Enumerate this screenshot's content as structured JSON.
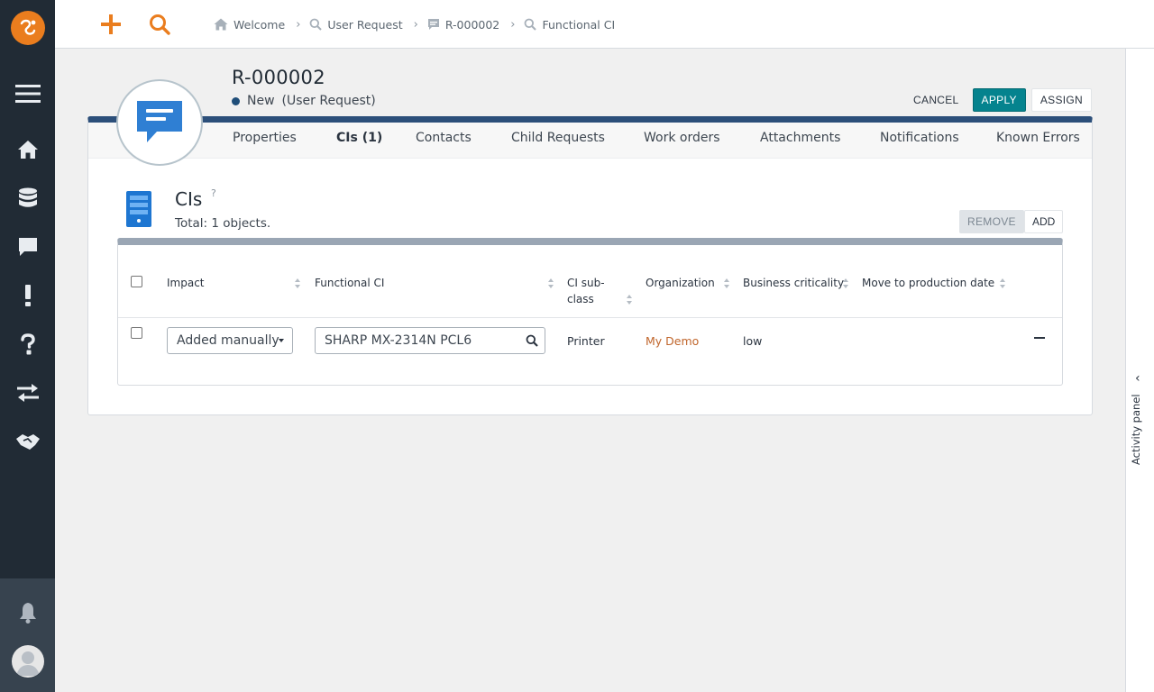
{
  "topbar": {
    "breadcrumb": [
      {
        "label": "Welcome",
        "icon": "home-icon"
      },
      {
        "label": "User Request",
        "icon": "search-icon"
      },
      {
        "label": "R-000002",
        "icon": "ticket-icon"
      },
      {
        "label": "Functional CI",
        "icon": "search-icon"
      }
    ]
  },
  "object": {
    "title": "R-000002",
    "status": "New",
    "class_label": "(User Request)",
    "actions": {
      "cancel": "CANCEL",
      "apply": "APPLY",
      "assign": "ASSIGN"
    }
  },
  "tabs": [
    {
      "label": "Properties",
      "active": false
    },
    {
      "label": "CIs (1)",
      "active": true
    },
    {
      "label": "Contacts",
      "active": false
    },
    {
      "label": "Child Requests",
      "active": false
    },
    {
      "label": "Work orders",
      "active": false
    },
    {
      "label": "Attachments",
      "active": false
    },
    {
      "label": "Notifications",
      "active": false
    },
    {
      "label": "Known Errors",
      "active": false
    }
  ],
  "cis": {
    "title": "CIs",
    "help": "?",
    "total": "Total: 1 objects.",
    "remove_label": "REMOVE",
    "add_label": "ADD",
    "columns": {
      "impact": "Impact",
      "functional_ci": "Functional CI",
      "ci_subclass_line1": "CI sub-",
      "ci_subclass_line2": "class",
      "organization": "Organization",
      "business_criticality": "Business criticality",
      "move_to_production": "Move to production date"
    },
    "rows": [
      {
        "impact": "Added manually",
        "functional_ci": "SHARP MX-2314N PCL6",
        "ci_subclass": "Printer",
        "organization": "My Demo",
        "business_criticality": "low",
        "move_to_production": ""
      }
    ]
  },
  "activity_panel": {
    "label": "Activity panel"
  },
  "colors": {
    "sidebar": "#212b35",
    "accent_orange": "#ea7d1e",
    "apply_teal": "#05838e",
    "tab_border": "#2c4f7a",
    "link": "#c0652b"
  }
}
